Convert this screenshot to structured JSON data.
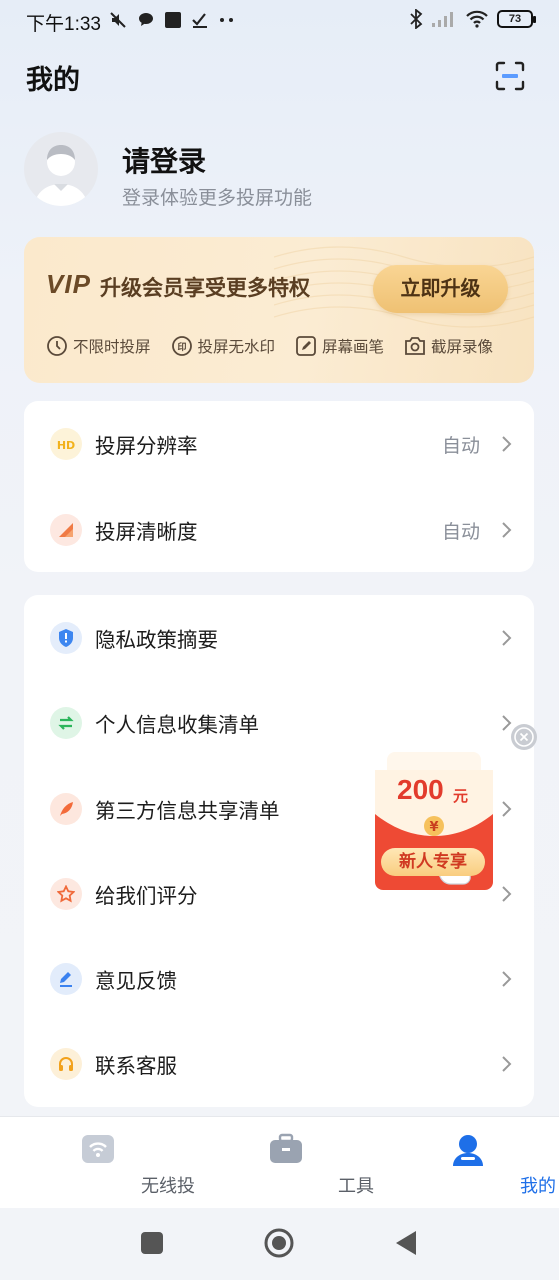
{
  "status_bar": {
    "time": "下午1:33",
    "battery": "73"
  },
  "header": {
    "title": "我的"
  },
  "profile": {
    "title": "请登录",
    "subtitle": "登录体验更多投屏功能"
  },
  "vip": {
    "logo": "VIP",
    "title": "升级会员享受更多特权",
    "button": "立即升级",
    "features": [
      "不限时投屏",
      "投屏无水印",
      "屏幕画笔",
      "截屏录像"
    ]
  },
  "settings": [
    {
      "label": "投屏分辨率",
      "value": "自动",
      "icon": "hd-icon"
    },
    {
      "label": "投屏清晰度",
      "value": "自动",
      "icon": "clarity-icon"
    }
  ],
  "menu": [
    {
      "label": "隐私政策摘要",
      "icon": "shield-icon"
    },
    {
      "label": "个人信息收集清单",
      "icon": "exchange-icon"
    },
    {
      "label": "第三方信息共享清单",
      "icon": "feather-icon"
    },
    {
      "label": "给我们评分",
      "icon": "star-icon"
    },
    {
      "label": "意见反馈",
      "icon": "pencil-icon"
    },
    {
      "label": "联系客服",
      "icon": "headset-icon"
    }
  ],
  "ad": {
    "amount": "200",
    "unit": "元",
    "coin": "¥",
    "tag": "新人专享"
  },
  "bottom_nav": [
    {
      "label": "无线投",
      "icon": "wireless-cast-icon",
      "active": false
    },
    {
      "label": "工具",
      "icon": "toolbox-icon",
      "active": false
    },
    {
      "label": "我的",
      "icon": "user-icon",
      "active": true
    }
  ],
  "colors": {
    "accent": "#1e6fe8",
    "vip_gold": "#efc173",
    "ad_red": "#e23b2c"
  }
}
